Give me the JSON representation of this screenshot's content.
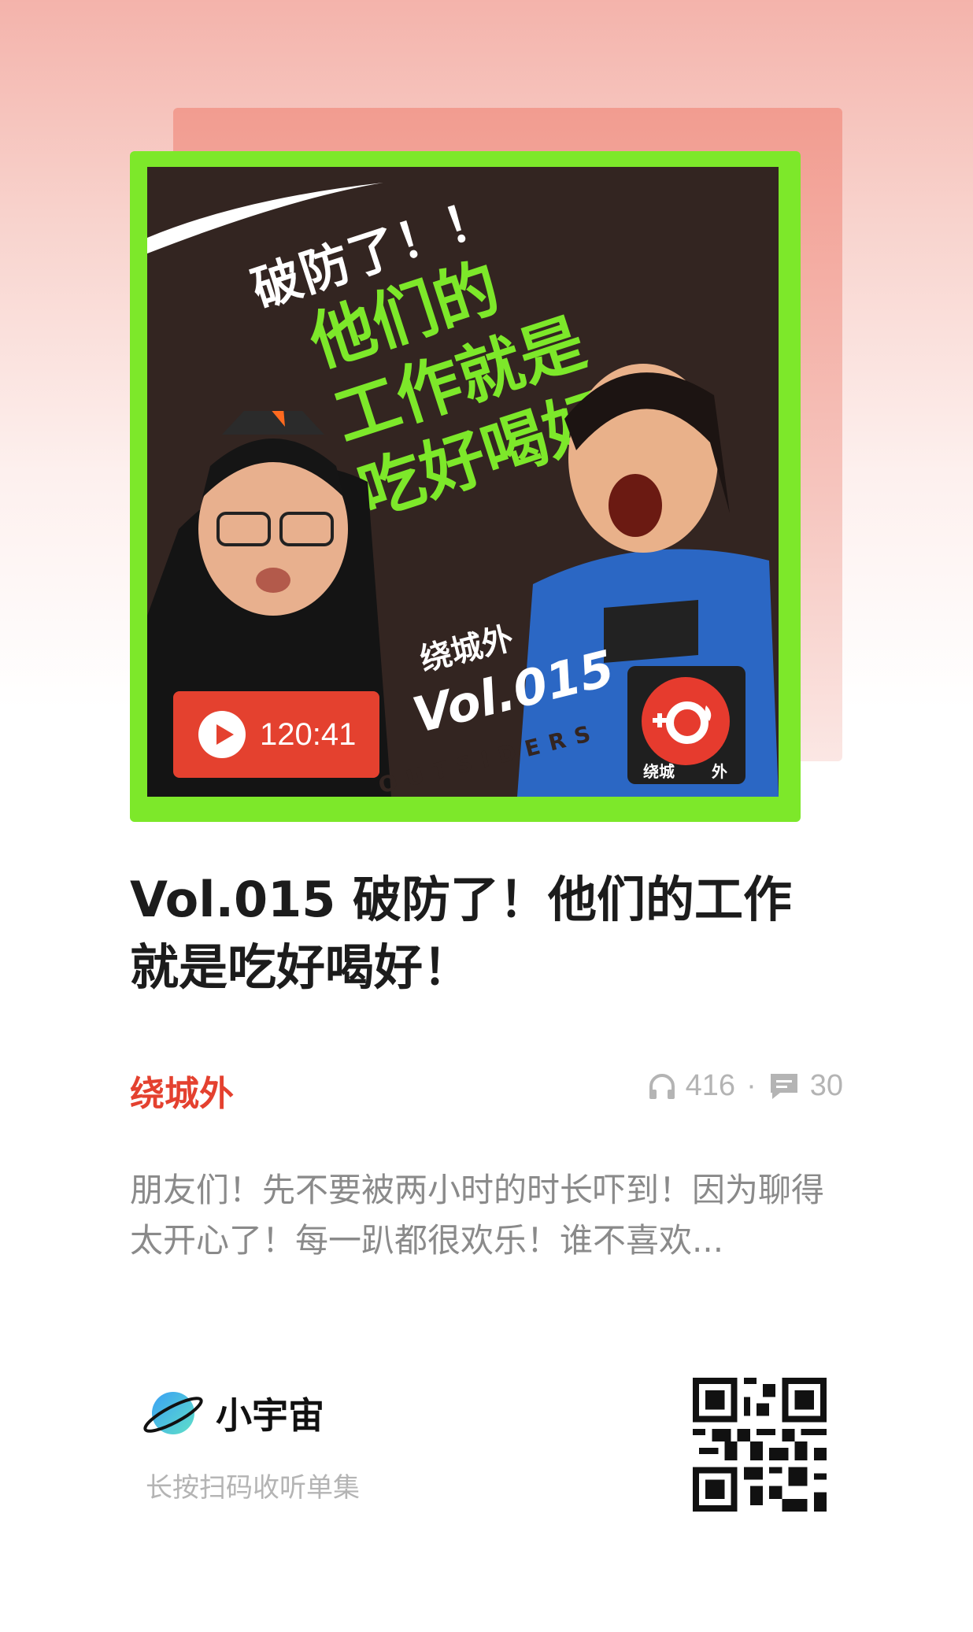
{
  "cover": {
    "headline_small": "破防了！！",
    "headline_main": [
      "他们的",
      "工作就是",
      "吃好喝好"
    ],
    "brand": "绕城外",
    "vol": "Vol.015",
    "outsiders": "OUTSIDERS",
    "logo_text": "绕城",
    "logo_text_2": "外",
    "duration": "120:41",
    "accent_green": "#7de82a",
    "accent_red": "#e4412f"
  },
  "episode": {
    "title": "Vol.015 破防了！他们的工作就是吃好喝好！",
    "podcast_name": "绕城外",
    "plays": "416",
    "separator": "·",
    "comments": "30",
    "description": "朋友们！先不要被两小时的时长吓到！因为聊得太开心了！每一趴都很欢乐！谁不喜欢..."
  },
  "footer": {
    "app_name": "小宇宙",
    "hint": "长按扫码收听单集",
    "icons": [
      "headphones-icon",
      "comment-icon",
      "planet-logo-icon",
      "qr-code"
    ]
  }
}
